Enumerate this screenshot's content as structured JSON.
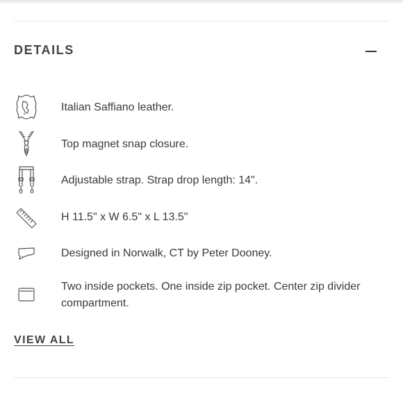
{
  "section": {
    "title": "DETAILS",
    "toggle_icon": "minus-icon"
  },
  "details": [
    {
      "icon": "leather-hide-icon",
      "text": "Italian Saffiano leather."
    },
    {
      "icon": "zipper-pull-icon",
      "text": "Top magnet snap closure."
    },
    {
      "icon": "strap-icon",
      "text": "Adjustable strap. Strap drop length: 14\"."
    },
    {
      "icon": "ruler-icon",
      "text": "H 11.5\" x W 6.5\" x L 13.5\""
    },
    {
      "icon": "connecticut-map-icon",
      "text": "Designed in Norwalk, CT by Peter Dooney."
    },
    {
      "icon": "pocket-icon",
      "text": "Two inside pockets. One inside zip pocket. Center zip divider compartment."
    }
  ],
  "view_all_label": "VIEW ALL"
}
